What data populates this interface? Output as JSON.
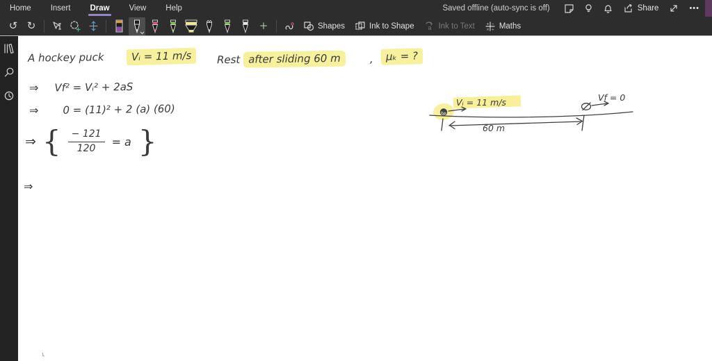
{
  "titlebar": {
    "menus": [
      "Home",
      "Insert",
      "Draw",
      "View",
      "Help"
    ],
    "active_menu": "Draw",
    "status": "Saved offline (auto-sync is off)",
    "share_label": "Share"
  },
  "ribbon": {
    "shapes_label": "Shapes",
    "ink_to_shape_label": "Ink to Shape",
    "ink_to_text_label": "Ink to Text",
    "maths_label": "Maths",
    "pens": [
      "eraser",
      "pen-black-selected",
      "pen-pink",
      "pen-green",
      "highlighter-yellow",
      "pencil",
      "pen-green-2",
      "pen-white"
    ]
  },
  "icons": {
    "undo": "↺",
    "redo": "↻",
    "add_pen": "+",
    "more": "•••",
    "note": "sticky-note-shape",
    "ideas": "lightbulb-shape",
    "notifications": "bell-shape",
    "share": "box-with-arrow-shape",
    "fullscreen": "diagonal-double-arrow-shape",
    "notebooks": "tilted-books-shape",
    "search": "magnifier-shape",
    "recent": "clock-shape"
  },
  "canvas": {
    "problem": {
      "lead": "A hockey puck",
      "given_velocity": "Vᵢ = 11 m/s",
      "condition_plain": "Rest",
      "condition_highlight": "after  sliding  60 m",
      "comma": ",",
      "unknown": "μₖ = ?"
    },
    "equations": [
      {
        "lead": "⇒",
        "text": "Vf² = Vᵢ² + 2aS"
      },
      {
        "lead": "⇒",
        "text": "0 = (11)² + 2 (a) (60)"
      },
      {
        "lead": "⇒",
        "brace_open": "{",
        "numerator": "− 121",
        "denominator": "120",
        "rhs": "= a",
        "brace_close": "}"
      },
      {
        "lead": "⇒"
      }
    ],
    "diagram": {
      "initial_velocity_label": "Vᵢ = 11 m/s",
      "final_velocity_label": "Vf = 0",
      "distance_label": "60 m"
    }
  },
  "colors": {
    "accent": "#9286c8",
    "highlight": "#f7f09c",
    "ink": "#3a3a3a",
    "chrome": "#2d2d2d",
    "rail": "#232323",
    "canvas": "#ffffff",
    "edge_strip": "#5e3a5e"
  }
}
